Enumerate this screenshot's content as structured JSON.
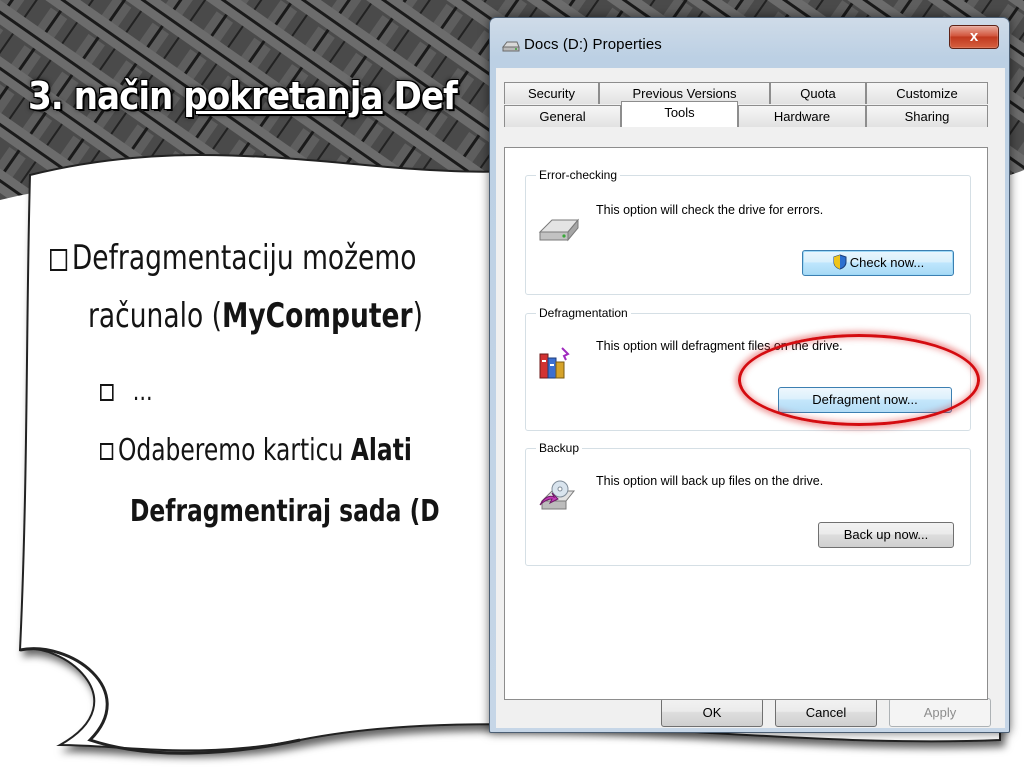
{
  "slide": {
    "title_part1": "3. način ",
    "title_part2": "pokretanja",
    "title_part3": " Def",
    "bullet1_text": "Defragmentaciju možemo",
    "bullet1_line2_pre": "računalo (",
    "bullet1_line2_bold": "MyComputer",
    "bullet1_line2_post": ")",
    "bullet2_text": "...",
    "bullet3_pre": "Odaberemo karticu ",
    "bullet3_bold": "Alati",
    "bullet3_line2_bold": "Defragmentiraj sada",
    "bullet3_line2_post": " (D"
  },
  "dialog": {
    "title": "Docs (D:) Properties",
    "close_label": "x",
    "tabs_row1": [
      "Security",
      "Previous Versions",
      "Quota",
      "Customize"
    ],
    "tabs_row2": [
      "General",
      "Tools",
      "Hardware",
      "Sharing"
    ],
    "active_tab": "Tools",
    "groups": {
      "error_checking": {
        "label": "Error-checking",
        "text": "This option will check the drive for errors.",
        "button": "Check now...",
        "icon": "drive-icon"
      },
      "defragmentation": {
        "label": "Defragmentation",
        "text": "This option will defragment files on the drive.",
        "button": "Defragment now...",
        "icon": "defrag-icon"
      },
      "backup": {
        "label": "Backup",
        "text": "This option will back up files on the drive.",
        "button": "Back up now...",
        "icon": "backup-icon"
      }
    },
    "footer": {
      "ok": "OK",
      "cancel": "Cancel",
      "apply": "Apply"
    }
  },
  "colors": {
    "highlight_ring": "#d40c10",
    "close_button": "#c0391f",
    "focus_button": "#a7d9f5"
  }
}
